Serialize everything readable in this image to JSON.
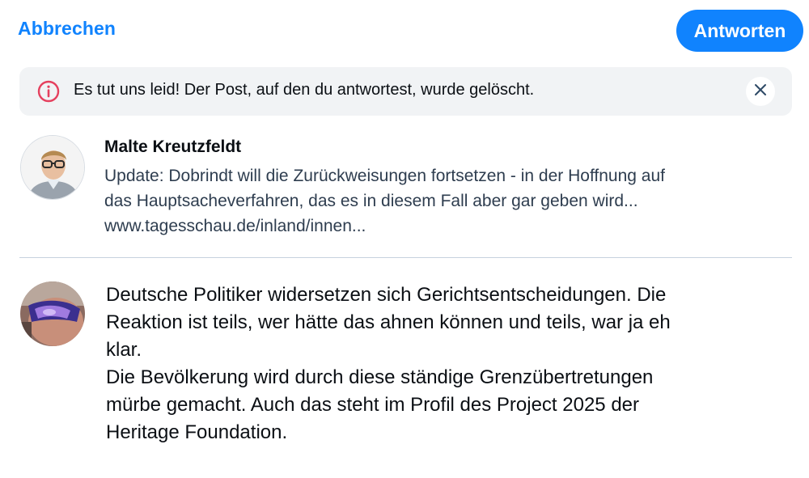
{
  "header": {
    "cancel_label": "Abbrechen",
    "reply_label": "Antworten"
  },
  "notice": {
    "icon": "info-circle-icon",
    "text": "Es tut uns leid! Der Post, auf den du antwortest, wurde gelöscht.",
    "close_icon": "close-icon"
  },
  "quoted_post": {
    "author": "Malte Kreutzfeldt",
    "lines": [
      "Update: Dobrindt will die Zurückweisungen fortsetzen - in der Hoffnung auf",
      "das Hauptsacheverfahren, das es in diesem Fall aber gar geben wird...",
      "www.tagesschau.de/inland/innen..."
    ]
  },
  "reply": {
    "lines": [
      "Deutsche Politiker widersetzen sich Gerichtsentscheidungen. Die",
      "Reaktion ist teils, wer hätte das ahnen können und teils, war ja eh",
      "klar.",
      "Die Bevölkerung wird durch diese ständige Grenzübertretungen",
      "mürbe gemacht. Auch das steht im Profil des Project 2025 der",
      "Heritage Foundation."
    ]
  },
  "colors": {
    "accent": "#1083fe",
    "notice_bg": "#f1f3f5",
    "notice_icon": "#e5405e",
    "quoted_text": "#2e3d4f",
    "divider": "#c7d2de"
  }
}
